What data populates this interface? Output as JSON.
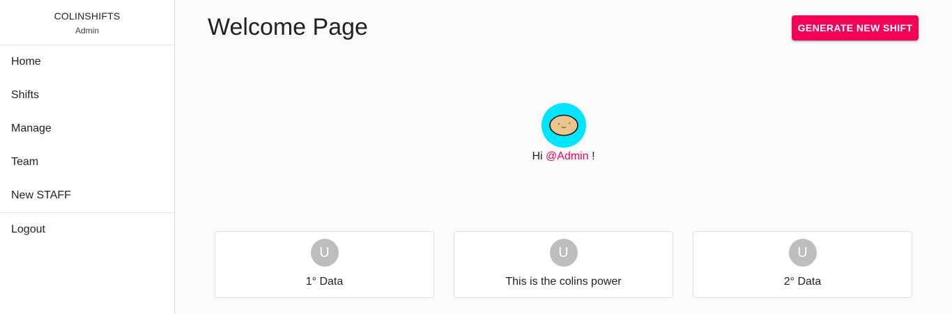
{
  "sidebar": {
    "brand_name": "COLINSHIFTS",
    "brand_role": "Admin",
    "items": [
      {
        "label": "Home"
      },
      {
        "label": "Shifts"
      },
      {
        "label": "Manage"
      },
      {
        "label": "Team"
      },
      {
        "label": "New STAFF"
      }
    ],
    "logout_label": "Logout"
  },
  "header": {
    "title": "Welcome Page",
    "generate_button_label": "GENERATE NEW SHIFT"
  },
  "hero": {
    "greeting_prefix": "Hi ",
    "handle": "@Admin",
    "greeting_suffix": " !"
  },
  "cards": [
    {
      "avatar_letter": "U",
      "label": "1° Data"
    },
    {
      "avatar_letter": "U",
      "label": "This is the colins power"
    },
    {
      "avatar_letter": "U",
      "label": "2° Data"
    }
  ],
  "colors": {
    "accent": "#f50057",
    "avatar_bg": "#00e5ff",
    "card_avatar_bg": "#bdbdbd"
  }
}
